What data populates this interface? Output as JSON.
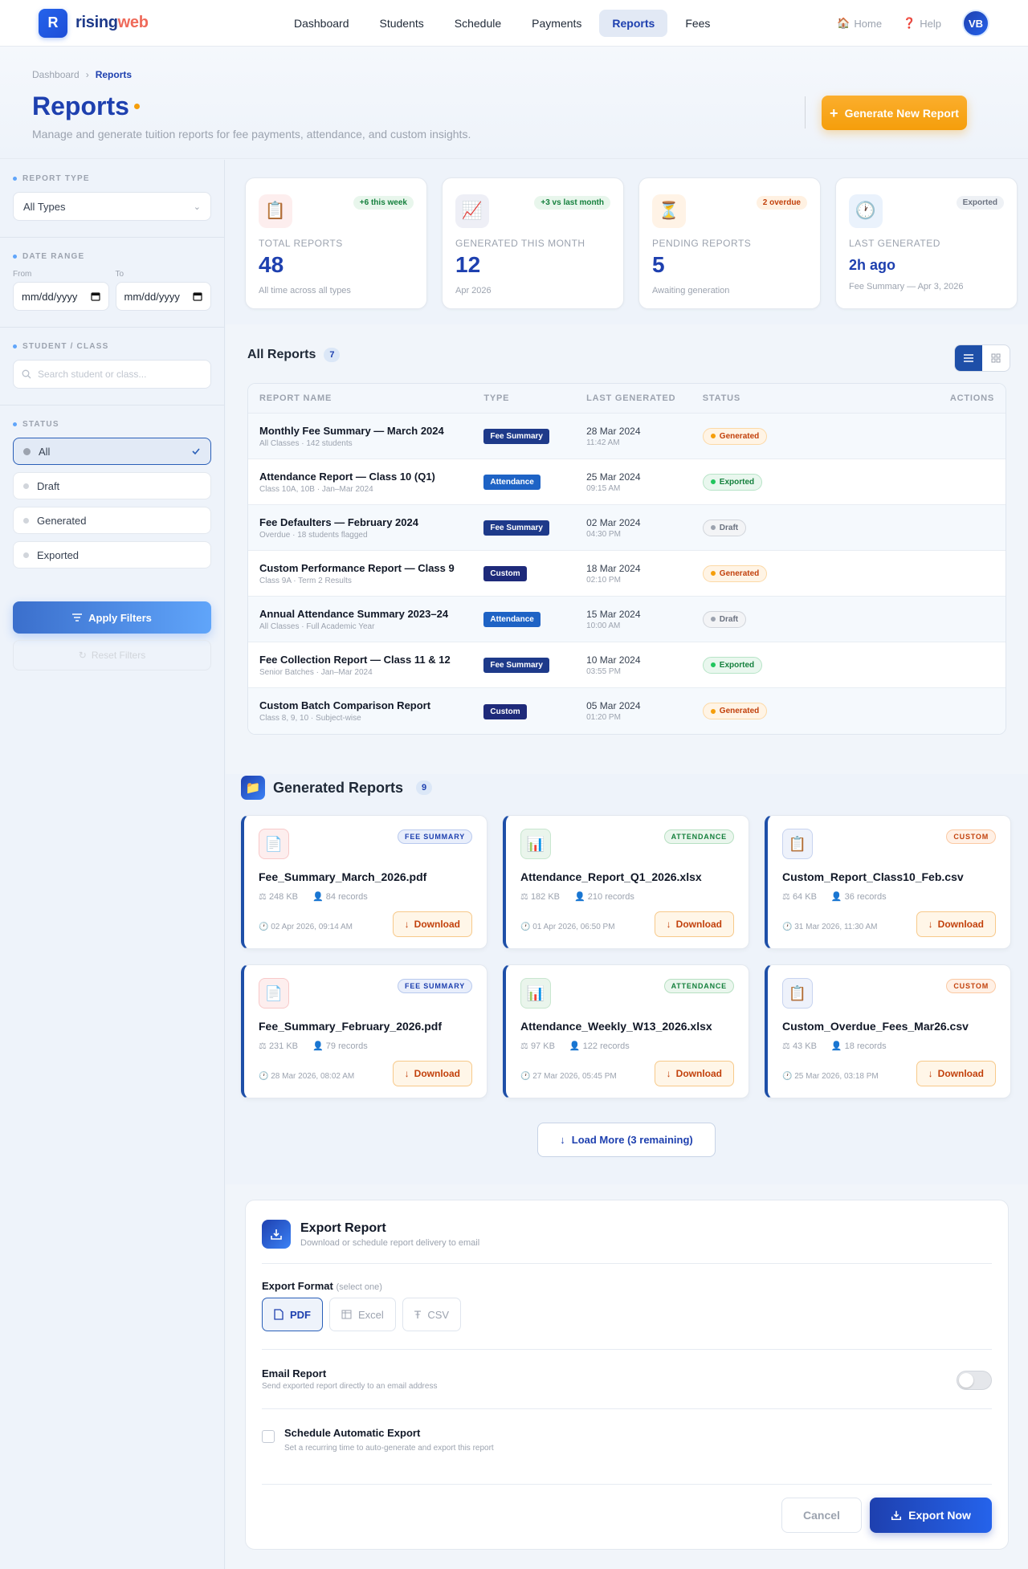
{
  "brand": {
    "logo_letter": "R",
    "name_a": "rising",
    "name_b": "web"
  },
  "nav": [
    {
      "label": "Dashboard"
    },
    {
      "label": "Students"
    },
    {
      "label": "Schedule"
    },
    {
      "label": "Payments"
    },
    {
      "label": "Reports"
    },
    {
      "label": "Fees"
    }
  ],
  "top_right": {
    "home": "Home",
    "help": "Help",
    "avatar": "VB"
  },
  "breadcrumb": {
    "parent": "Dashboard",
    "current": "Reports"
  },
  "page": {
    "title": "Reports",
    "subtitle": "Manage and generate tuition reports for fee payments, attendance, and custom insights.",
    "generate_label": "Generate New Report"
  },
  "filters": {
    "report_type_label": "REPORT TYPE",
    "report_type_value": "All Types",
    "date_range_label": "DATE RANGE",
    "from_label": "From",
    "to_label": "To",
    "from_value": "mm/dd/yyyy",
    "to_value": "mm/dd/yyyy",
    "student_label": "STUDENT / CLASS",
    "student_placeholder": "Search student or class...",
    "status_label": "STATUS",
    "status_options": [
      "All",
      "Draft",
      "Generated",
      "Exported"
    ],
    "apply_label": "Apply Filters",
    "reset_label": "Reset Filters"
  },
  "stats": [
    {
      "label": "TOTAL REPORTS",
      "value": "48",
      "sub": "All time across all types",
      "badge": "+6 this week",
      "icon": "clipboard-icon"
    },
    {
      "label": "GENERATED THIS MONTH",
      "value": "12",
      "sub": "Apr 2026",
      "badge": "+3 vs last month",
      "icon": "chart-icon"
    },
    {
      "label": "PENDING REPORTS",
      "value": "5",
      "sub": "Awaiting generation",
      "badge": "2 overdue",
      "icon": "hourglass-icon"
    },
    {
      "label": "LAST GENERATED",
      "value": "2h ago",
      "sub": "Fee Summary — Apr 3, 2026",
      "badge": "Exported",
      "icon": "clock-icon"
    }
  ],
  "reports": {
    "title": "All Reports",
    "count": "7",
    "columns": [
      "REPORT NAME",
      "TYPE",
      "LAST GENERATED",
      "STATUS",
      "ACTIONS"
    ],
    "rows": [
      {
        "name": "Monthly Fee Summary — March 2024",
        "sub": "All Classes · 142 students",
        "type": "Fee Summary",
        "date": "28 Mar 2024",
        "time": "11:42 AM",
        "status": "Generated"
      },
      {
        "name": "Attendance Report — Class 10 (Q1)",
        "sub": "Class 10A, 10B · Jan–Mar 2024",
        "type": "Attendance",
        "date": "25 Mar 2024",
        "time": "09:15 AM",
        "status": "Exported"
      },
      {
        "name": "Fee Defaulters — February 2024",
        "sub": "Overdue · 18 students flagged",
        "type": "Fee Summary",
        "date": "02 Mar 2024",
        "time": "04:30 PM",
        "status": "Draft"
      },
      {
        "name": "Custom Performance Report — Class 9",
        "sub": "Class 9A · Term 2 Results",
        "type": "Custom",
        "date": "18 Mar 2024",
        "time": "02:10 PM",
        "status": "Generated"
      },
      {
        "name": "Annual Attendance Summary 2023–24",
        "sub": "All Classes · Full Academic Year",
        "type": "Attendance",
        "date": "15 Mar 2024",
        "time": "10:00 AM",
        "status": "Draft"
      },
      {
        "name": "Fee Collection Report — Class 11 & 12",
        "sub": "Senior Batches · Jan–Mar 2024",
        "type": "Fee Summary",
        "date": "10 Mar 2024",
        "time": "03:55 PM",
        "status": "Exported"
      },
      {
        "name": "Custom Batch Comparison Report",
        "sub": "Class 8, 9, 10 · Subject-wise",
        "type": "Custom",
        "date": "05 Mar 2024",
        "time": "01:20 PM",
        "status": "Generated"
      }
    ]
  },
  "generated": {
    "title": "Generated Reports",
    "count": "9",
    "download_label": "Download",
    "files": [
      {
        "tag": "FEE SUMMARY",
        "kind": "pdf",
        "name": "Fee_Summary_March_2026.pdf",
        "size": "248 KB",
        "records": "84 records",
        "date": "02 Apr 2026, 09:14 AM"
      },
      {
        "tag": "ATTENDANCE",
        "kind": "xls",
        "name": "Attendance_Report_Q1_2026.xlsx",
        "size": "182 KB",
        "records": "210 records",
        "date": "01 Apr 2026, 06:50 PM"
      },
      {
        "tag": "CUSTOM",
        "kind": "csv",
        "name": "Custom_Report_Class10_Feb.csv",
        "size": "64 KB",
        "records": "36 records",
        "date": "31 Mar 2026, 11:30 AM"
      },
      {
        "tag": "FEE SUMMARY",
        "kind": "pdf",
        "name": "Fee_Summary_February_2026.pdf",
        "size": "231 KB",
        "records": "79 records",
        "date": "28 Mar 2026, 08:02 AM"
      },
      {
        "tag": "ATTENDANCE",
        "kind": "xls",
        "name": "Attendance_Weekly_W13_2026.xlsx",
        "size": "97 KB",
        "records": "122 records",
        "date": "27 Mar 2026, 05:45 PM"
      },
      {
        "tag": "CUSTOM",
        "kind": "csv",
        "name": "Custom_Overdue_Fees_Mar26.csv",
        "size": "43 KB",
        "records": "18 records",
        "date": "25 Mar 2026, 03:18 PM"
      }
    ],
    "load_more": "Load More (3 remaining)"
  },
  "export": {
    "title": "Export Report",
    "subtitle": "Download or schedule report delivery to email",
    "format_label": "Export Format",
    "format_hint": "(select one)",
    "formats": [
      "PDF",
      "Excel",
      "CSV"
    ],
    "email_title": "Email Report",
    "email_sub": "Send exported report directly to an email address",
    "email_enabled": false,
    "schedule_title": "Schedule Automatic Export",
    "schedule_sub": "Set a recurring time to auto-generate and export this report",
    "cancel_label": "Cancel",
    "export_label": "Export Now"
  }
}
